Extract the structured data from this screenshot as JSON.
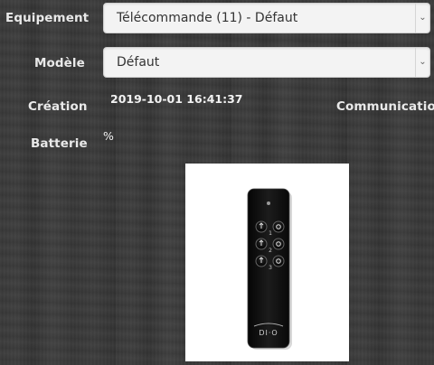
{
  "labels": {
    "equipement": "Equipement",
    "modele": "Modèle",
    "creation": "Création",
    "communication": "Communication",
    "batterie": "Batterie"
  },
  "fields": {
    "equipement_value": "Télécommande (11) - Défaut",
    "modele_value": "Défaut",
    "creation_value": "2019-10-01 16:41:37",
    "batterie_value": "%"
  },
  "device_image": {
    "brand_text": "DI·O",
    "button_numbers": [
      "1",
      "2",
      "3"
    ]
  },
  "colors": {
    "background": "#3a3a3a",
    "label_text": "#e9e9e9",
    "select_bg": "#f3f3f3",
    "remote_body": "#141414"
  }
}
